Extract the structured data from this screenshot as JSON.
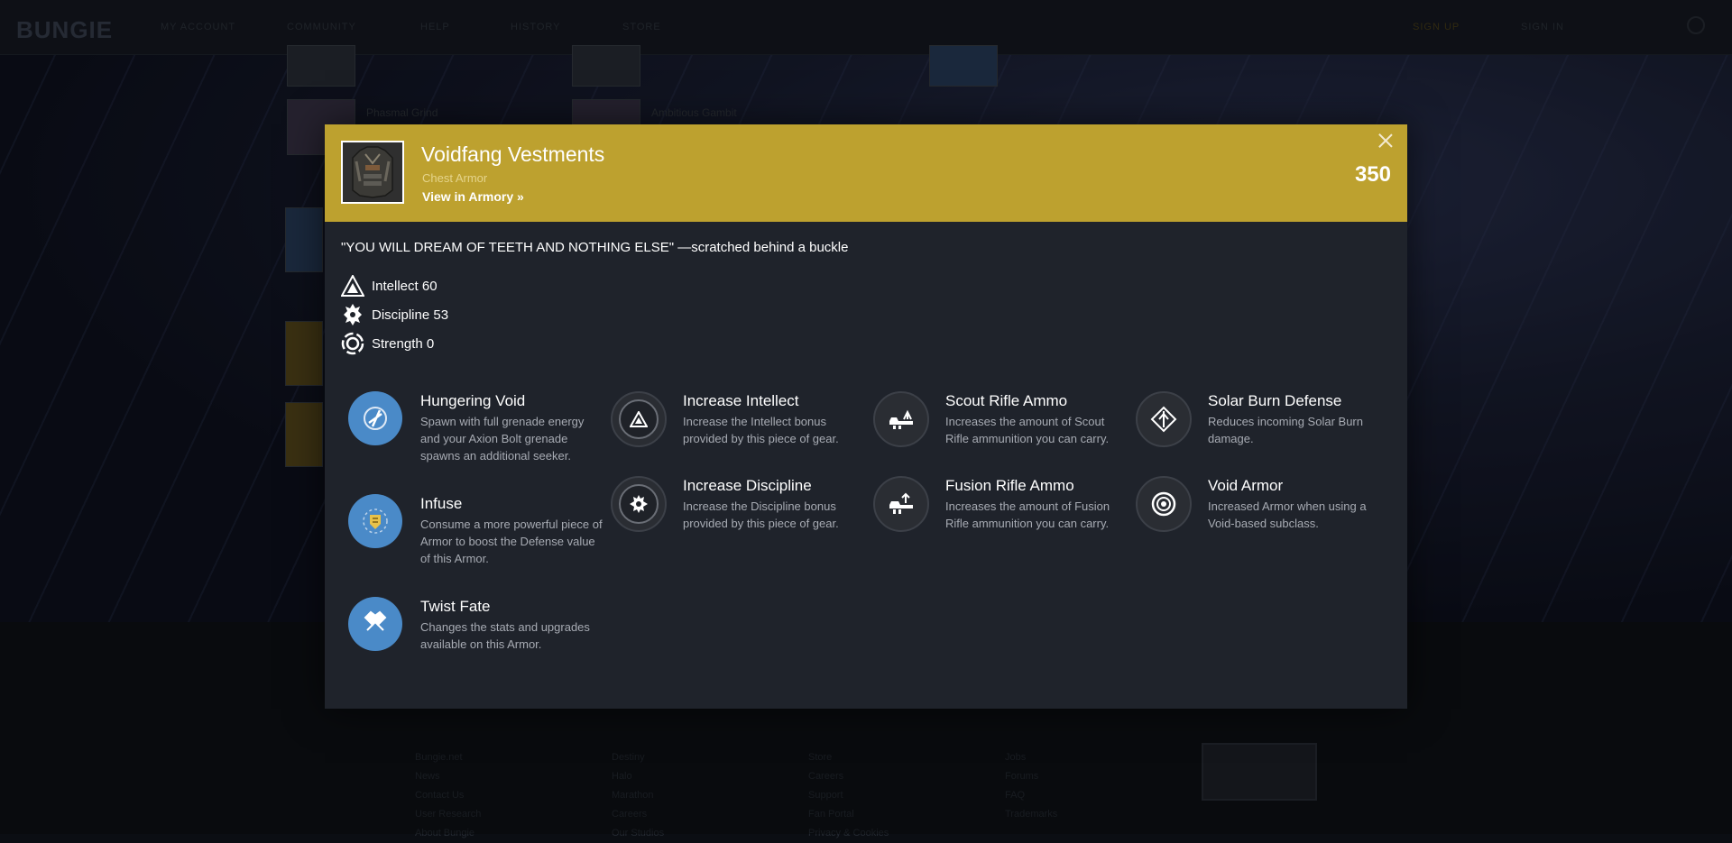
{
  "background": {
    "logo": "BUNGIE",
    "nav": [
      "MY ACCOUNT",
      "COMMUNITY",
      "HELP",
      "HISTORY",
      "STORE"
    ],
    "nav_right": [
      "SIGN UP",
      "SIGN IN"
    ],
    "tile_labels": [
      "Phasmal Grind",
      "Ambitious Gambit"
    ],
    "footer_links": [
      [
        "Bungie.net",
        "News",
        "Contact Us",
        "User Research",
        "About Bungie"
      ],
      [
        "Destiny",
        "Halo",
        "Marathon",
        "Careers",
        "Our Studios"
      ],
      [
        "Store",
        "Careers",
        "Support",
        "Fan Portal",
        "Privacy & Cookies"
      ],
      [
        "Jobs",
        "Forums",
        "FAQ",
        "Trademarks"
      ]
    ]
  },
  "item": {
    "name": "Voidfang Vestments",
    "type": "Chest Armor",
    "armory_link": "View in Armory »",
    "power": "350",
    "flavor": "\"YOU WILL DREAM OF TEETH AND NOTHING ELSE\" —scratched behind a buckle",
    "stats": [
      {
        "label": "Intellect 60",
        "icon": "intellect-icon"
      },
      {
        "label": "Discipline 53",
        "icon": "discipline-icon"
      },
      {
        "label": "Strength 0",
        "icon": "strength-icon"
      }
    ]
  },
  "perks": [
    {
      "title": "Hungering Void",
      "desc": "Spawn with full grenade energy and your Axion Bolt grenade spawns an additional seeker.",
      "icon": "axion-bolt-icon"
    },
    {
      "title": "Increase Intellect",
      "desc": "Increase the Intellect bonus provided by this piece of gear.",
      "icon": "intellect-perk-icon"
    },
    {
      "title": "Scout Rifle Ammo",
      "desc": "Increases the amount of Scout Rifle ammunition you can carry.",
      "icon": "scout-rifle-icon"
    },
    {
      "title": "Solar Burn Defense",
      "desc": "Reduces incoming Solar Burn damage.",
      "icon": "solar-defense-icon"
    },
    {
      "title": "Infuse",
      "desc": "Consume a more powerful piece of Armor to boost the Defense value of this Armor.",
      "icon": "infuse-icon"
    },
    {
      "title": "Increase Discipline",
      "desc": "Increase the Discipline bonus provided by this piece of gear.",
      "icon": "discipline-perk-icon"
    },
    {
      "title": "Fusion Rifle Ammo",
      "desc": "Increases the amount of Fusion Rifle ammunition you can carry.",
      "icon": "fusion-rifle-icon"
    },
    {
      "title": "Void Armor",
      "desc": "Increased Armor when using a Void-based subclass.",
      "icon": "void-armor-icon"
    },
    {
      "title": "Twist Fate",
      "desc": "Changes the stats and upgrades available on this Armor.",
      "icon": "twist-fate-icon"
    }
  ],
  "colors": {
    "header_gold": "#bda12f",
    "modal_bg": "#1f232b",
    "active_perk_blue": "#4a8ac8",
    "muted_text": "#a7abb3"
  }
}
